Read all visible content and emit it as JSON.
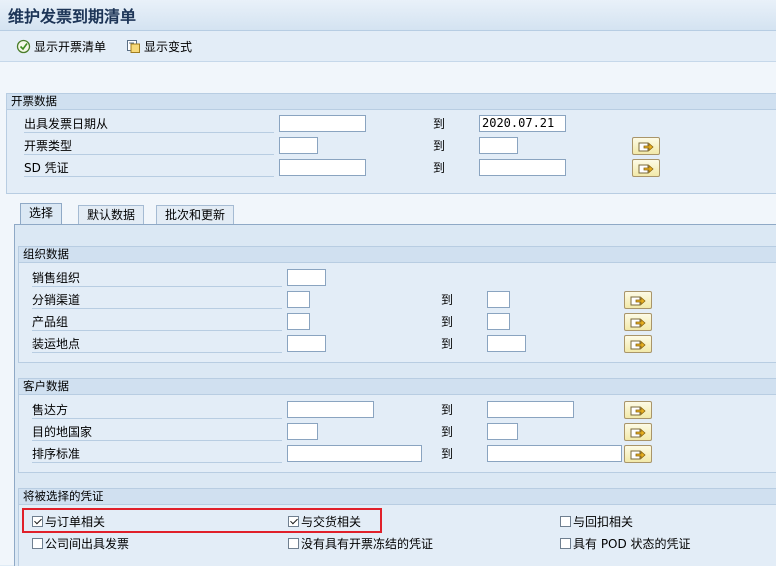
{
  "window": {
    "title": "维护发票到期清单"
  },
  "toolbar": {
    "show_billing_list": "显示开票清单",
    "show_variant": "显示变式"
  },
  "billing_data": {
    "title": "开票数据",
    "rows": [
      {
        "label": "出具发票日期从",
        "from": "",
        "to_label": "到",
        "to": "2020.07.21"
      },
      {
        "label": "开票类型",
        "from": "",
        "to_label": "到",
        "to": ""
      },
      {
        "label": "SD 凭证",
        "from": "",
        "to_label": "到",
        "to": ""
      }
    ]
  },
  "tabs": [
    {
      "label": "选择",
      "active": true
    },
    {
      "label": "默认数据",
      "active": false
    },
    {
      "label": "批次和更新",
      "active": false
    }
  ],
  "org_data": {
    "title": "组织数据",
    "rows": [
      {
        "label": "销售组织",
        "from": "",
        "to_label": "",
        "to": ""
      },
      {
        "label": "分销渠道",
        "from": "",
        "to_label": "到",
        "to": ""
      },
      {
        "label": "产品组",
        "from": "",
        "to_label": "到",
        "to": ""
      },
      {
        "label": "装运地点",
        "from": "",
        "to_label": "到",
        "to": ""
      }
    ]
  },
  "customer_data": {
    "title": "客户数据",
    "rows": [
      {
        "label": "售达方",
        "from": "",
        "to_label": "到",
        "to": ""
      },
      {
        "label": "目的地国家",
        "from": "",
        "to_label": "到",
        "to": ""
      },
      {
        "label": "排序标准",
        "from": "",
        "to_label": "到",
        "to": ""
      }
    ]
  },
  "documents": {
    "title": "将被选择的凭证",
    "options": [
      {
        "label": "与订单相关",
        "checked": true
      },
      {
        "label": "与交货相关",
        "checked": true
      },
      {
        "label": "与回扣相关",
        "checked": false
      },
      {
        "label": "公司间出具发票",
        "checked": false
      },
      {
        "label": "没有具有开票冻结的凭证",
        "checked": false
      },
      {
        "label": "具有 POD 状态的凭证",
        "checked": false
      }
    ]
  },
  "icons": {
    "execute": "execute-clock-icon",
    "variant": "variant-icon",
    "multiple_selection": "multiple-selection-arrow-icon"
  }
}
